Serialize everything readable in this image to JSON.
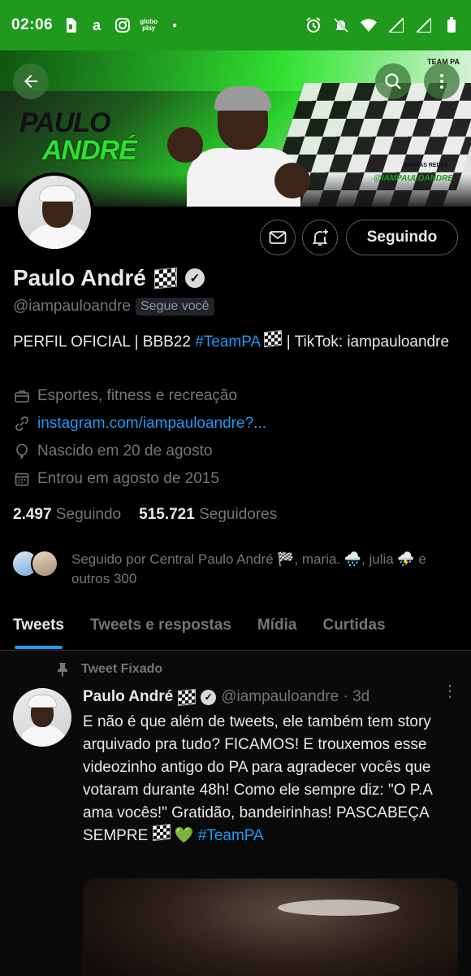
{
  "status_bar": {
    "time": "02:06",
    "icons": [
      "sim-icon",
      "amazon-icon",
      "instagram-icon",
      "globoplay-icon",
      "dot-icon"
    ],
    "globoplay_label": "globo play",
    "right_icons": [
      "alarm-icon",
      "mute-icon",
      "wifi-icon",
      "signal-icon",
      "signal-icon",
      "battery-icon"
    ]
  },
  "banner": {
    "name_line1": "PAULO",
    "name_line2": "ANDRÉ",
    "minhas_redes": "MINHAS REDES",
    "handle_tag": "@IAMPAULOANDRE",
    "corner_tag": "TEAM PA"
  },
  "profile": {
    "display_name": "Paulo André",
    "handle": "@iampauloandre",
    "follows_you": "Segue você",
    "bio_prefix": "PERFIL OFICIAL | BBB22 ",
    "bio_hashtag": "#TeamPA",
    "bio_suffix": " | TikTok: iampauloandre",
    "category": "Esportes, fitness e recreação",
    "website": "instagram.com/iampauloandre?...",
    "birthday": "Nascido em 20 de agosto",
    "joined": "Entrou em agosto de 2015",
    "following_count": "2.497",
    "following_label": "Seguindo",
    "followers_count": "515.721",
    "followers_label": "Seguidores",
    "followed_by": "Seguido por Central Paulo André 🏁, maria. 🌧️, julia ⛈️ e outros 300"
  },
  "actions": {
    "follow_button": "Seguindo"
  },
  "tabs": [
    {
      "label": "Tweets",
      "active": true
    },
    {
      "label": "Tweets e respostas",
      "active": false
    },
    {
      "label": "Mídia",
      "active": false
    },
    {
      "label": "Curtidas",
      "active": false
    }
  ],
  "tweet": {
    "pinned_label": "Tweet Fixado",
    "author": "Paulo André",
    "handle_time": "@iampauloandre · 3d",
    "text": "E não é que além de tweets, ele também tem story arquivado pra tudo? FICAMOS! E trouxemos esse videozinho antigo do PA para agradecer vocês que votaram durante 48h! Como ele sempre diz: \"O P.A ama vocês!\" Gratidão, bandeirinhas! PASCABEÇA SEMPRE",
    "hashtag": "#TeamPA"
  },
  "colors": {
    "status_bar": "#1f9a1c",
    "accent_blue": "#1d9bf0",
    "secondary_text": "#71767b",
    "background": "#000000"
  }
}
